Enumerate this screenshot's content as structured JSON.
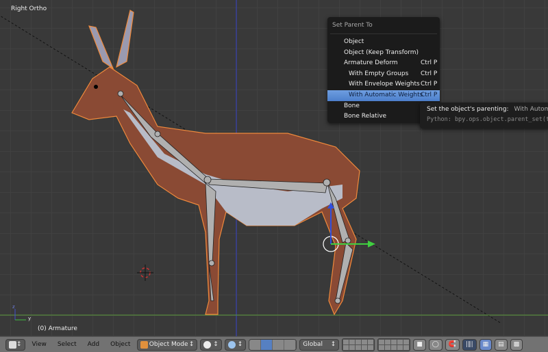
{
  "viewport": {
    "view_label": "Right Ortho",
    "object_label": "(0) Armature",
    "axis_y": "y",
    "axis_z": "z"
  },
  "menu": {
    "title": "Set Parent To",
    "items": [
      {
        "label": "Object",
        "shortcut": "",
        "sub": false
      },
      {
        "label": "Object (Keep Transform)",
        "shortcut": "",
        "sub": false
      },
      {
        "label": "Armature Deform",
        "shortcut": "Ctrl P",
        "sub": false
      },
      {
        "label": "With Empty Groups",
        "shortcut": "Ctrl P",
        "sub": true
      },
      {
        "label": "With Envelope Weights",
        "shortcut": "Ctrl P",
        "sub": true
      },
      {
        "label": "With Automatic Weights",
        "shortcut": "Ctrl P",
        "sub": true,
        "active": true
      },
      {
        "label": "Bone",
        "shortcut": "",
        "sub": false
      },
      {
        "label": "Bone Relative",
        "shortcut": "",
        "sub": false
      }
    ]
  },
  "tooltip": {
    "heading": "Set the object's parenting:",
    "value": "With Automatic Weights",
    "python": "Python: bpy.ops.object.parent_set(type='ARMATURE_AUTO')"
  },
  "header": {
    "menus": [
      "View",
      "Select",
      "Add",
      "Object"
    ],
    "mode": "Object Mode",
    "orientation": "Global"
  },
  "colors": {
    "mesh": "#8a4a34",
    "selection": "#f08a3c",
    "highlight": "#5680c2"
  }
}
